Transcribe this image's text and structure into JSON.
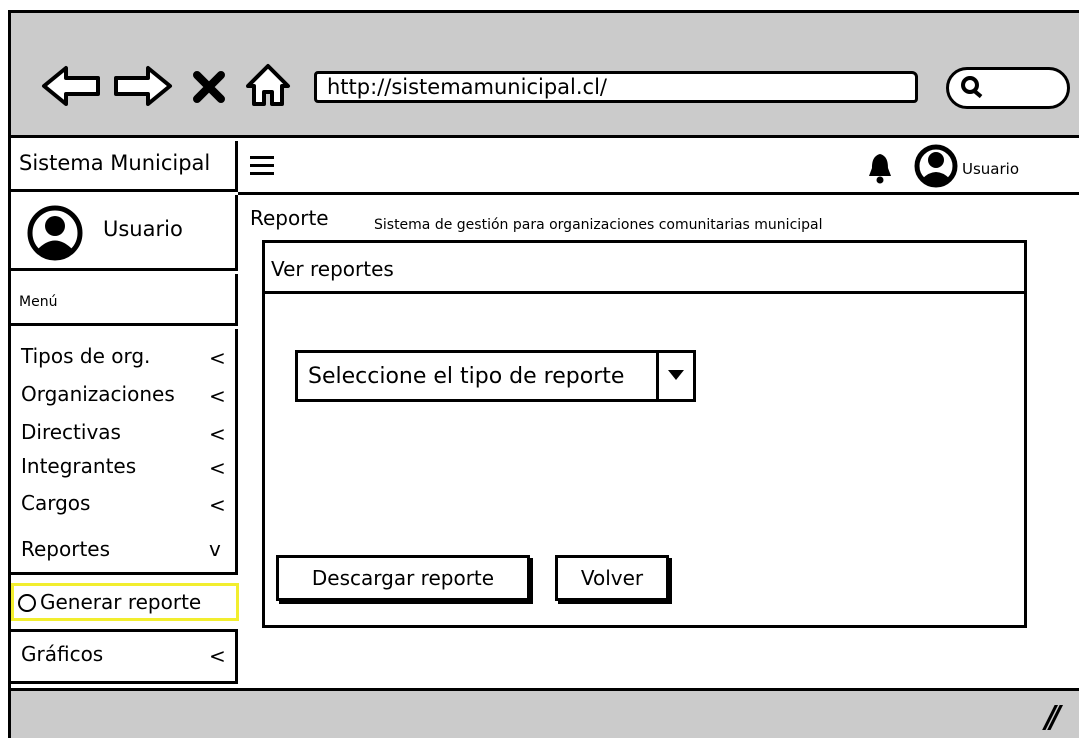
{
  "browser": {
    "url": "http://sistemamunicipal.cl/"
  },
  "sidebar": {
    "brand": "Sistema Municipal",
    "user_label": "Usuario",
    "menu_header": "Menú",
    "items": [
      {
        "label": "Tipos de org.",
        "arrow": "<"
      },
      {
        "label": "Organizaciones",
        "arrow": "<"
      },
      {
        "label": "Directivas",
        "arrow": "<"
      },
      {
        "label": "Integrantes",
        "arrow": "<"
      },
      {
        "label": "Cargos",
        "arrow": "<"
      },
      {
        "label": "Reportes",
        "arrow": "v"
      }
    ],
    "active_subitem": "Generar reporte",
    "graficos": {
      "label": "Gráficos",
      "arrow": "<"
    },
    "highlight_color": "#f2ee2e"
  },
  "topbar": {
    "user_label": "Usuario"
  },
  "main": {
    "title": "Reporte",
    "subtitle": "Sistema de gestión para organizaciones comunitarias municipal",
    "panel_title": "Ver reportes",
    "select_value": "Seleccione el tipo de reporte",
    "download_button": "Descargar reporte",
    "back_button": "Volver"
  }
}
